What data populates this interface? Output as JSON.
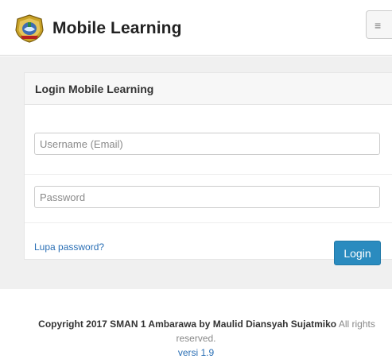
{
  "header": {
    "title": "Mobile Learning",
    "logo_icon": "school-emblem-icon",
    "menu_icon": "hamburger-menu-icon",
    "menu_glyph": "≡"
  },
  "login_panel": {
    "heading": "Login Mobile Learning",
    "username_placeholder": "Username (Email)",
    "username_value": "",
    "password_placeholder": "Password",
    "password_value": "",
    "forgot_link": "Lupa password?",
    "login_button": "Login"
  },
  "footer": {
    "copyright_strong": "Copyright 2017 SMAN 1 Ambarawa by Maulid Diansyah Sujatmiko",
    "copyright_rest": "All rights",
    "reserved": "reserved.",
    "version": "versi 1.9"
  },
  "colors": {
    "accent": "#2a8bbf",
    "link": "#2a6fb5",
    "background": "#f0f0f0"
  }
}
